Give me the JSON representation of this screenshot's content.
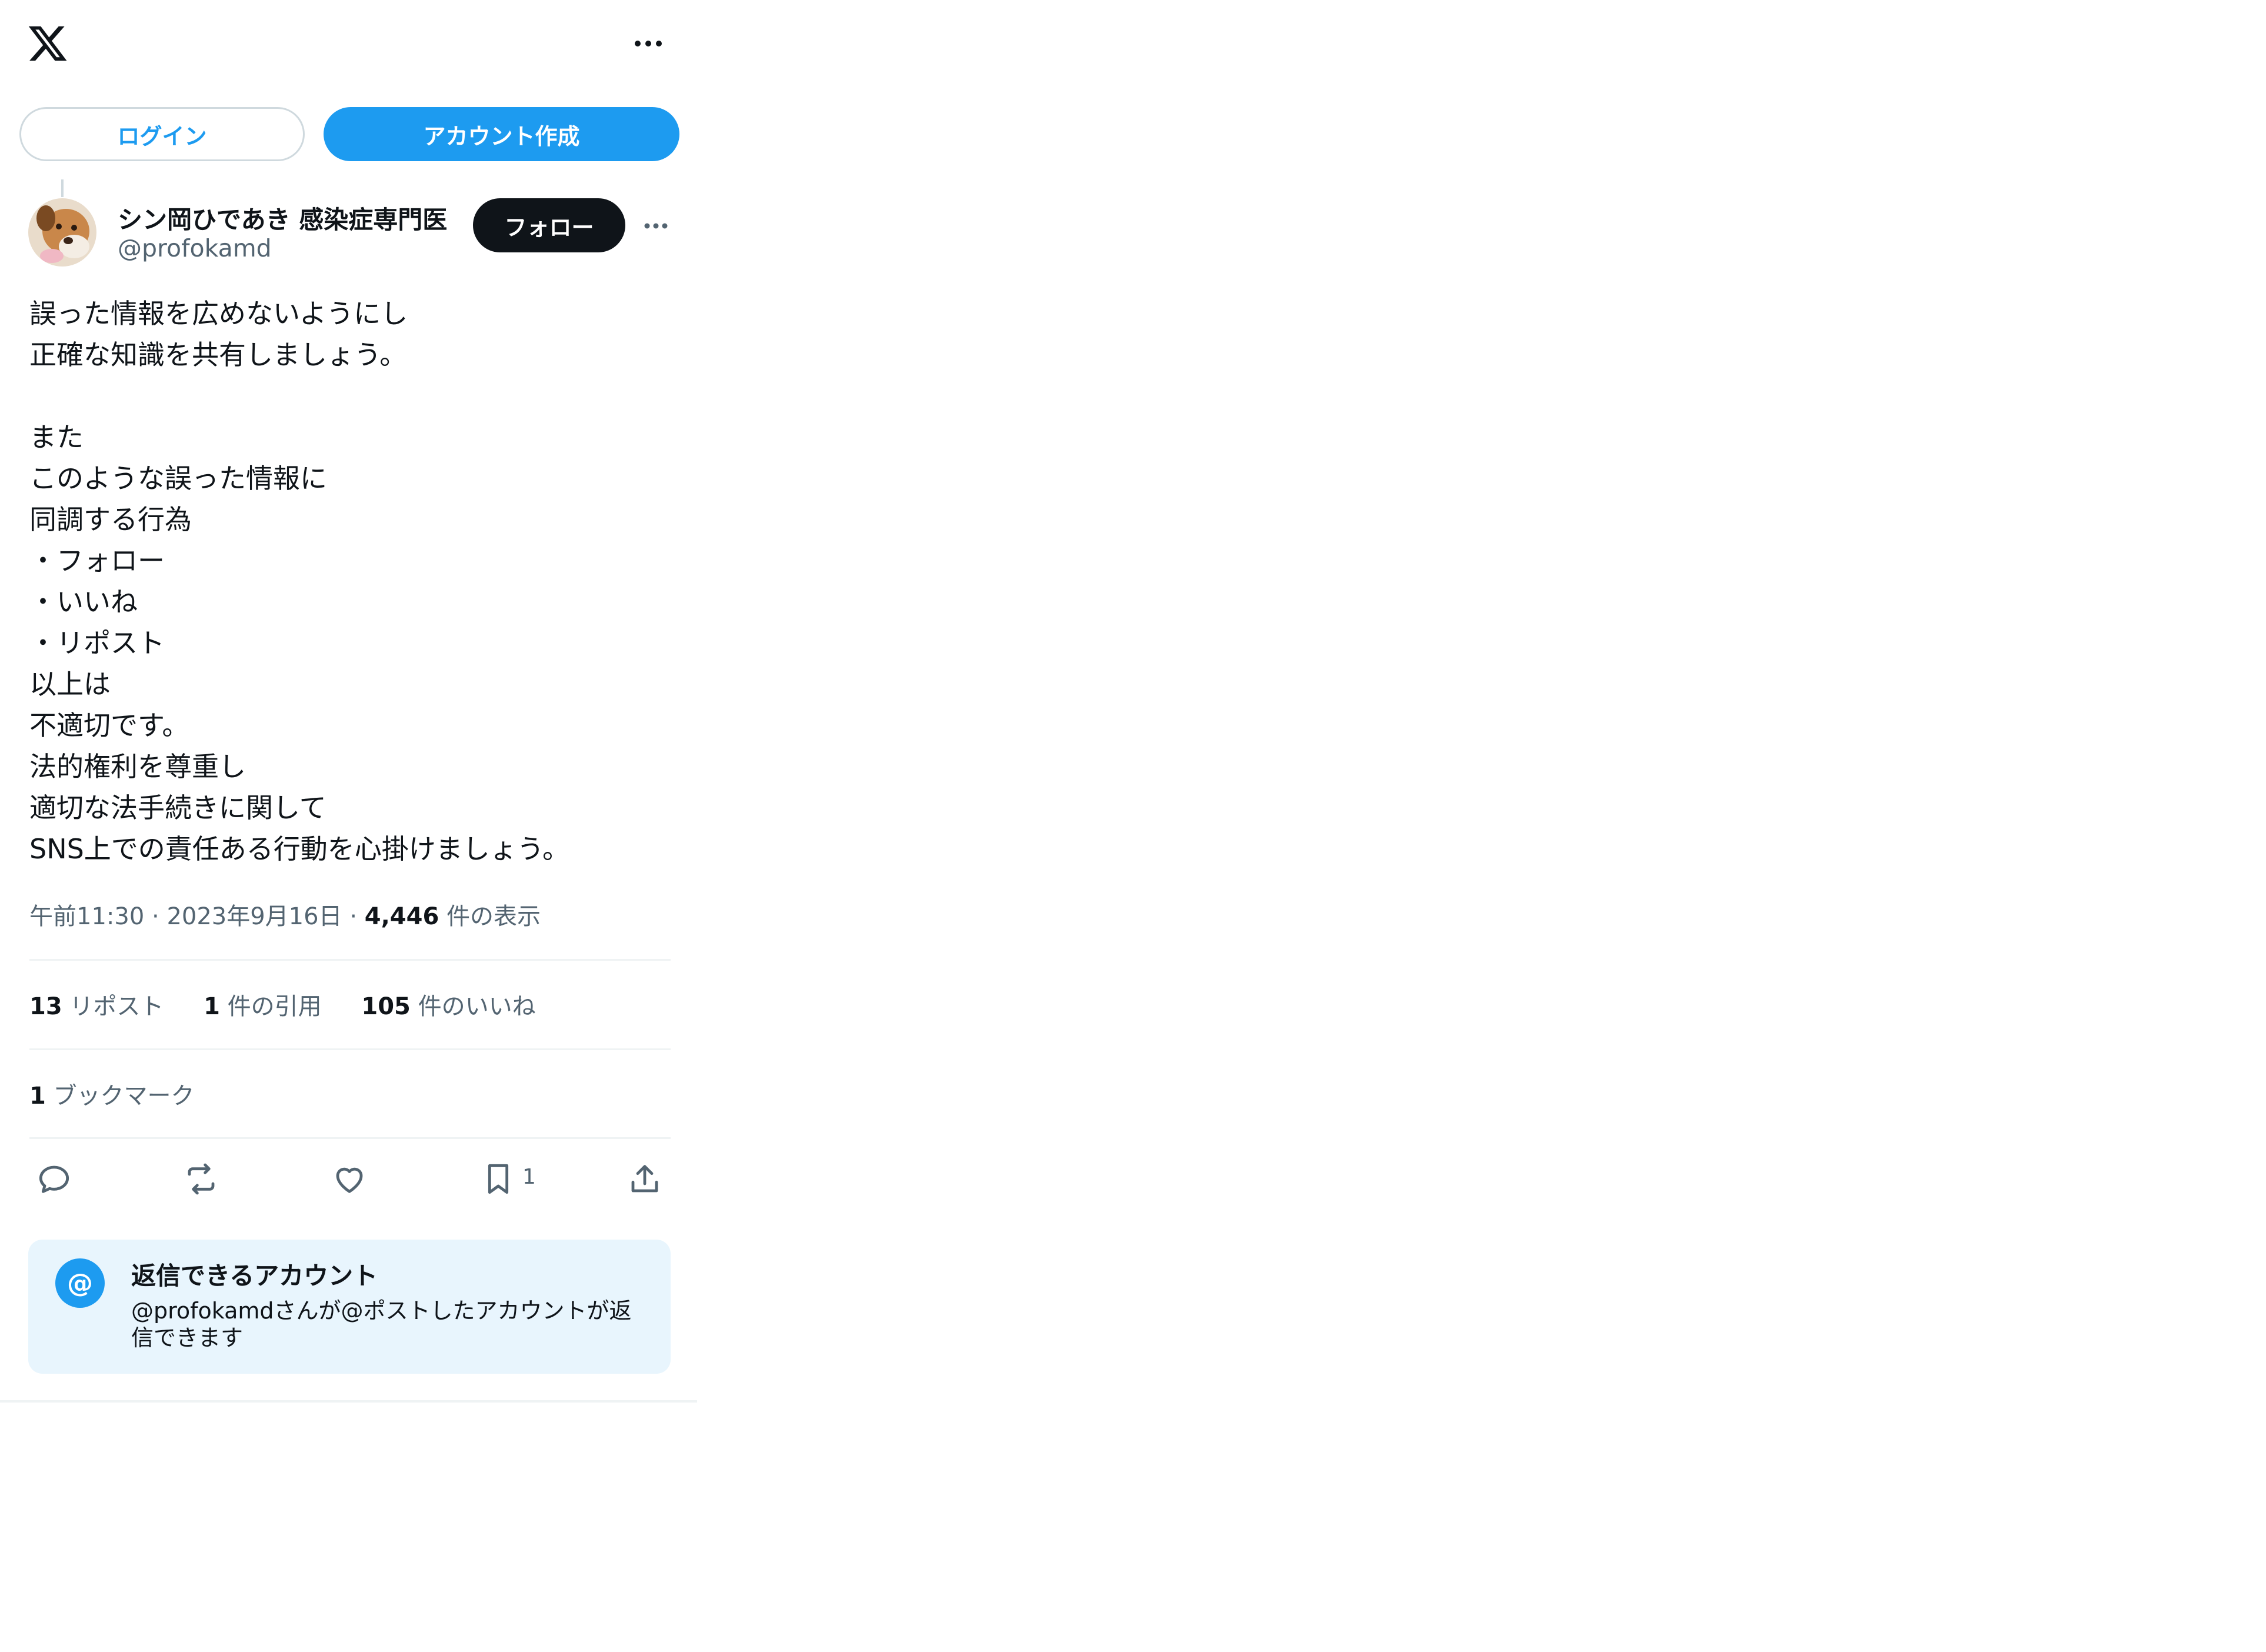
{
  "colors": {
    "accent": "#1d9bf0",
    "text": "#0f1419",
    "muted": "#536471",
    "divider": "#eff3f4",
    "reply_bg": "#e8f5fd"
  },
  "header": {
    "logo_icon": "x-logo-icon",
    "more_icon": "more-horizontal-icon"
  },
  "auth": {
    "login_label": "ログイン",
    "signup_label": "アカウント作成"
  },
  "author": {
    "display_name": "シン岡ひであき 感染症専門医",
    "handle": "@profokamd",
    "follow_label": "フォロー"
  },
  "post": {
    "lines": [
      "誤った情報を広めないようにし",
      "正確な知識を共有しましょう。",
      "",
      "また",
      "このような誤った情報に",
      "同調する行為",
      "・フォロー",
      "・いいね",
      "・リポスト",
      "以上は",
      "不適切です。",
      "法的権利を尊重し",
      "適切な法手続きに関して",
      "SNS上での責任ある行動を心掛けましょう。"
    ],
    "time": "午前11:30",
    "date": "2023年9月16日",
    "separator": "·",
    "views_count": "4,446",
    "views_label": "件の表示"
  },
  "stats": {
    "reposts_count": "13",
    "reposts_label": "リポスト",
    "quotes_count": "1",
    "quotes_label": "件の引用",
    "likes_count": "105",
    "likes_label": "件のいいね",
    "bookmarks_count": "1",
    "bookmarks_label": "ブックマーク"
  },
  "actions": {
    "icons": [
      "reply-icon",
      "repost-icon",
      "like-icon",
      "bookmark-icon",
      "share-icon"
    ],
    "bookmark_count": "1"
  },
  "reply_restriction": {
    "icon_text": "@",
    "title": "返信できるアカウント",
    "description": "@profokamdさんが@ポストしたアカウントが返信できます"
  }
}
